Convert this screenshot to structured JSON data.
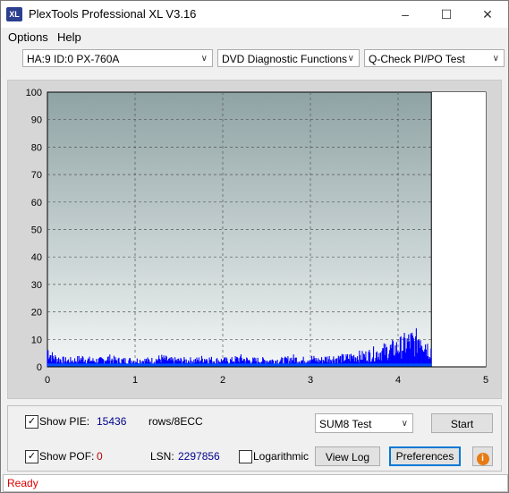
{
  "window": {
    "title": "PlexTools Professional XL V3.16",
    "icon_text": "XL"
  },
  "menu": [
    {
      "label": "Options"
    },
    {
      "label": "Help"
    }
  ],
  "selectors": {
    "drive": "HA:9 ID:0  PX-760A",
    "function": "DVD Diagnostic Functions",
    "test": "Q-Check PI/PO Test"
  },
  "chart_data": {
    "type": "bar",
    "x_ticks": [
      "0",
      "1",
      "2",
      "3",
      "4",
      "5"
    ],
    "y_ticks": [
      "0",
      "10",
      "20",
      "30",
      "40",
      "50",
      "60",
      "70",
      "80",
      "90",
      "100"
    ],
    "xlim": [
      0,
      5
    ],
    "ylim": [
      0,
      100
    ],
    "grid": true,
    "end_of_data_x": 4.38,
    "series": [
      {
        "color": "#0000ff",
        "values_description": "PIE sum8 per position",
        "x": [
          0.0,
          0.05,
          0.1,
          0.2,
          0.3,
          0.4,
          0.5,
          0.6,
          0.7,
          0.8,
          0.9,
          1.0,
          1.1,
          1.2,
          1.3,
          1.4,
          1.5,
          1.6,
          1.7,
          1.8,
          1.9,
          2.0,
          2.1,
          2.2,
          2.3,
          2.4,
          2.5,
          2.6,
          2.7,
          2.8,
          2.9,
          3.0,
          3.1,
          3.2,
          3.3,
          3.4,
          3.5,
          3.6,
          3.7,
          3.8,
          3.9,
          4.0,
          4.05,
          4.1,
          4.15,
          4.2,
          4.25,
          4.3,
          4.35
        ],
        "y": [
          8,
          5,
          4,
          3,
          3,
          4,
          3,
          3,
          4,
          3,
          3,
          3,
          3,
          3,
          4,
          3,
          3,
          3,
          3,
          4,
          3,
          3,
          3,
          4,
          3,
          3,
          3,
          3,
          3,
          4,
          3,
          4,
          3,
          4,
          4,
          4,
          5,
          5,
          6,
          7,
          8,
          9,
          10,
          11,
          12,
          11,
          16,
          12,
          8
        ]
      }
    ]
  },
  "bottom": {
    "show_pie_label": "Show PIE:",
    "pie_value": "15436",
    "pie_unit": "rows/8ECC",
    "show_pof_label": "Show POF:",
    "pof_value": "0",
    "lsn_label": "LSN:",
    "lsn_value": "2297856",
    "log_label": "Logarithmic",
    "test_select": "SUM8 Test",
    "start_label": "Start",
    "viewlog_label": "View Log",
    "prefs_label": "Preferences"
  },
  "status": {
    "text": "Ready"
  },
  "colors": {
    "plot_top": "#8fa3a4",
    "plot_bottom": "#f3f6f6",
    "series": "#0000ff",
    "status_text": "#e00000"
  }
}
